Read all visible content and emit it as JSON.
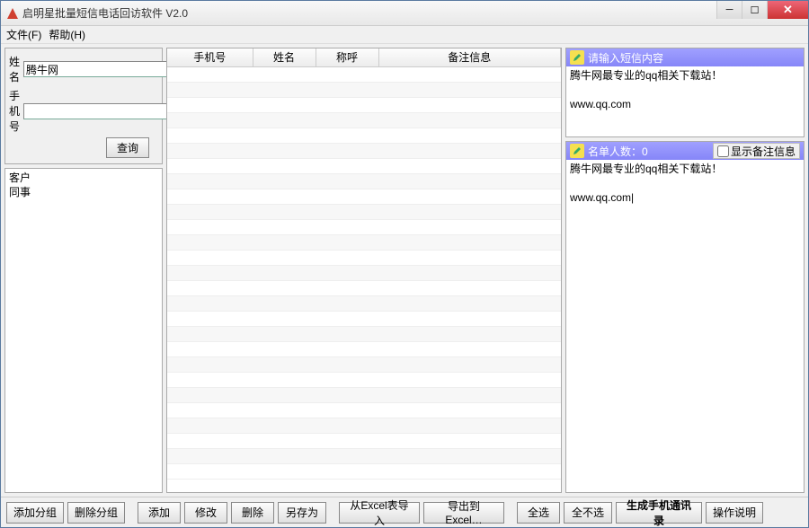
{
  "window": {
    "title": "启明星批量短信电话回访软件 V2.0"
  },
  "menubar": {
    "file": "文件(F)",
    "help": "帮助(H)"
  },
  "search": {
    "name_label": "姓 名",
    "name_value": "腾牛网",
    "phone_label": "手机号",
    "phone_value": "",
    "query_btn": "查询"
  },
  "groups": [
    "客户",
    "同事"
  ],
  "table": {
    "cols": [
      "手机号",
      "姓名",
      "称呼",
      "备注信息"
    ],
    "col_widths": [
      "95px",
      "70px",
      "70px",
      "auto"
    ],
    "rows": 27
  },
  "sms_panel": {
    "title": "请输入短信内容",
    "body": "腾牛网最专业的qq相关下载站！\n\nwww.qq.com"
  },
  "list_panel": {
    "title": "名单人数：0",
    "show_remark_label": "显示备注信息",
    "body": "腾牛网最专业的qq相关下载站！\n\nwww.qq.com"
  },
  "bottom": {
    "add_group": "添加分组",
    "del_group": "删除分组",
    "add": "添加",
    "edit": "修改",
    "del": "删除",
    "saveas": "另存为",
    "import": "从Excel表导入",
    "export": "导出到Excel…",
    "sel_all": "全选",
    "sel_none": "全不选",
    "gen": "生成手机通讯录",
    "manual": "操作说明"
  }
}
